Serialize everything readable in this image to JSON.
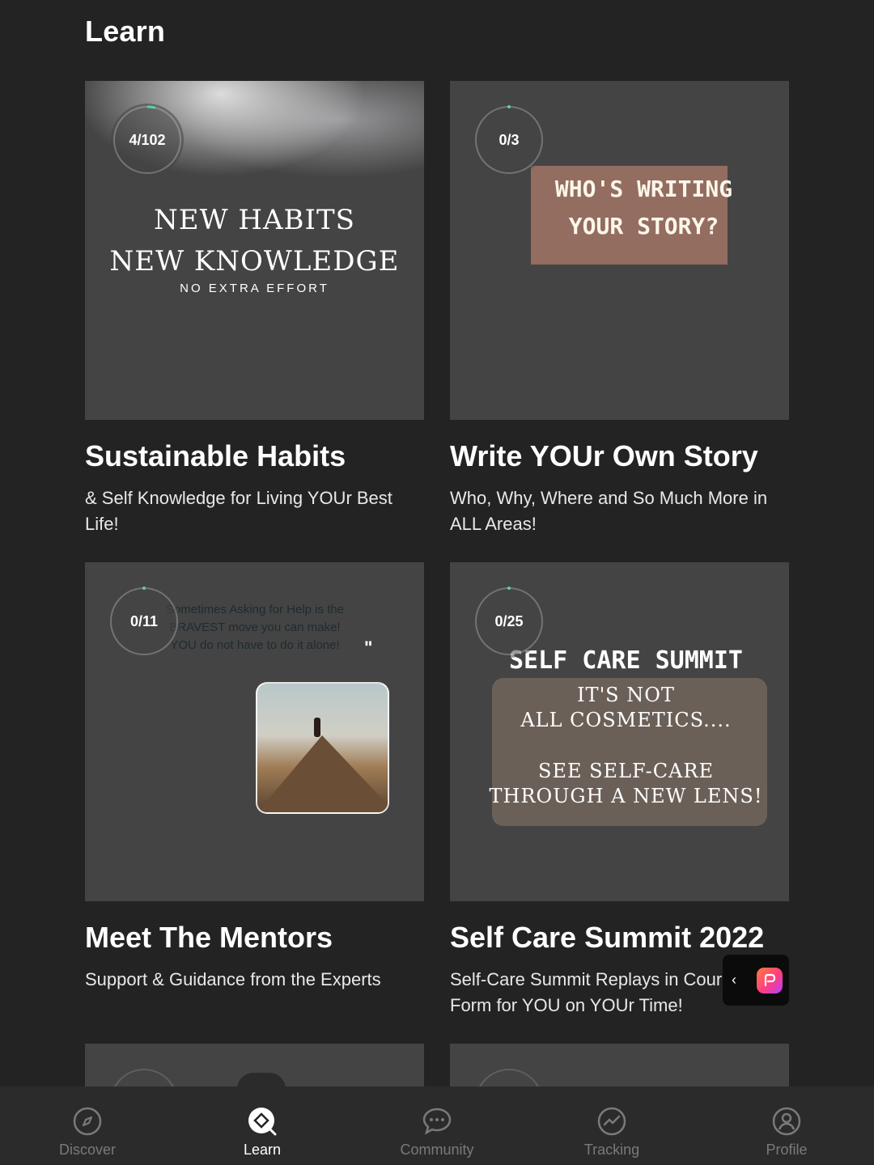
{
  "header": {
    "title": "Learn"
  },
  "courses": [
    {
      "title": "Sustainable Habits",
      "description": "& Self Knowledge for Living YOUr Best Life!",
      "progress": {
        "label": "4/102",
        "fraction": 0.039
      },
      "thumb_text": [
        "NEW HABITS",
        "NEW KNOWLEDGE",
        "NO EXTRA EFFORT"
      ]
    },
    {
      "title": "Write YOUr Own Story",
      "description": "Who, Why, Where and So Much More in ALL Areas!",
      "progress": {
        "label": "0/3",
        "fraction": 0
      },
      "thumb_text": [
        "WHO'S WRITING",
        "YOUR STORY?"
      ]
    },
    {
      "title": "Meet The Mentors",
      "description": "Support & Guidance from the Experts",
      "progress": {
        "label": "0/11",
        "fraction": 0
      },
      "thumb_text": [
        "Sometimes Asking for Help is the BRAVEST move you can make!",
        "YOU do not have to do it alone!",
        "\""
      ]
    },
    {
      "title": "Self Care Summit 2022",
      "description": "Self-Care Summit Replays in Cour",
      "description_line2": "Form for YOU on YOUr Time!",
      "progress": {
        "label": "0/25",
        "fraction": 0
      },
      "thumb_text": [
        "SELF CARE SUMMIT",
        "IT'S NOT",
        "ALL COSMETICS....",
        "SEE SELF-CARE",
        "THROUGH A NEW LENS!"
      ]
    }
  ],
  "widget": {
    "chevron": "‹",
    "icon": "app-badge-icon"
  },
  "nav": {
    "items": [
      {
        "label": "Discover",
        "icon": "compass-icon"
      },
      {
        "label": "Learn",
        "icon": "learn-icon",
        "active": true
      },
      {
        "label": "Community",
        "icon": "chat-bubble-icon"
      },
      {
        "label": "Tracking",
        "icon": "tracking-icon"
      },
      {
        "label": "Profile",
        "icon": "profile-icon"
      }
    ]
  },
  "colors": {
    "background": "#232323",
    "nav_bg": "#2b2b2b",
    "inactive": "#7a7a7a",
    "progress_accent": "#5ccfa7"
  }
}
